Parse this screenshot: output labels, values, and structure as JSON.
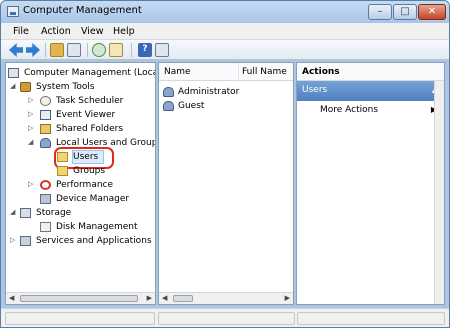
{
  "window": {
    "title": "Computer Management",
    "controls": {
      "minimize": "–",
      "maximize": "□",
      "close": "✕"
    }
  },
  "menu": {
    "file": "File",
    "action": "Action",
    "view": "View",
    "help": "Help"
  },
  "toolbar": {
    "help_glyph": "?"
  },
  "tree": {
    "root": "Computer Management (Local",
    "system_tools": "System Tools",
    "task_scheduler": "Task Scheduler",
    "event_viewer": "Event Viewer",
    "shared_folders": "Shared Folders",
    "local_users_groups": "Local Users and Groups",
    "users": "Users",
    "groups": "Groups",
    "performance": "Performance",
    "device_manager": "Device Manager",
    "storage": "Storage",
    "disk_management": "Disk Management",
    "services_apps": "Services and Applications",
    "expand_glyph": "▷",
    "collapse_glyph": "◢"
  },
  "list": {
    "columns": [
      "Name",
      "Full Name"
    ],
    "rows": [
      {
        "name": "Administrator",
        "full_name": ""
      },
      {
        "name": "Guest",
        "full_name": ""
      }
    ]
  },
  "actions": {
    "header": "Actions",
    "section": "Users",
    "section_collapse_glyph": "▲",
    "item": "More Actions",
    "item_arrow": "▶"
  },
  "scroll": {
    "left": "◀",
    "right": "▶"
  },
  "colors": {
    "selection_highlight": "#e0281f",
    "actions_section": "#4f7fbf"
  }
}
